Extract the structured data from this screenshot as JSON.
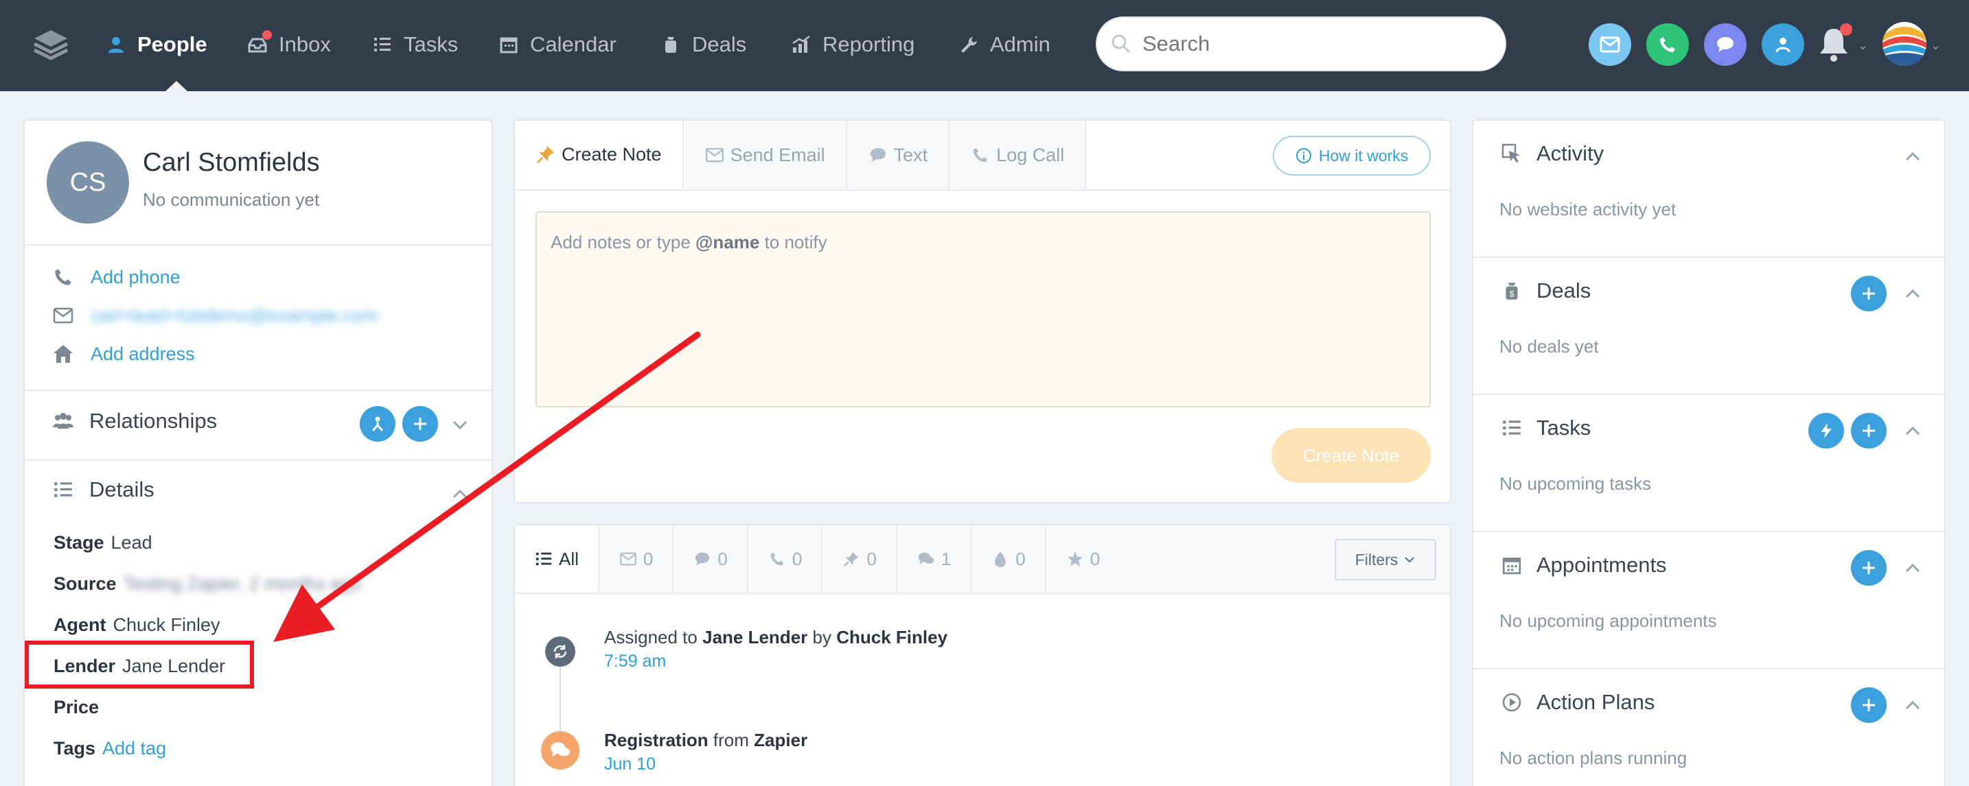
{
  "topnav": {
    "items": [
      {
        "label": "People",
        "icon": "people-icon",
        "active": true
      },
      {
        "label": "Inbox",
        "icon": "inbox-icon",
        "active": false
      },
      {
        "label": "Tasks",
        "icon": "tasks-icon",
        "active": false
      },
      {
        "label": "Calendar",
        "icon": "calendar-icon",
        "active": false
      },
      {
        "label": "Deals",
        "icon": "deals-icon",
        "active": false
      },
      {
        "label": "Reporting",
        "icon": "reporting-icon",
        "active": false
      },
      {
        "label": "Admin",
        "icon": "admin-icon",
        "active": false
      }
    ],
    "search_placeholder": "Search"
  },
  "contact": {
    "initials": "CS",
    "name": "Carl Stomfields",
    "status": "No communication yet",
    "add_phone": "Add phone",
    "email": "carl+lead+fubdemo@example.com",
    "add_address": "Add address"
  },
  "relationships": {
    "title": "Relationships"
  },
  "details": {
    "title": "Details",
    "stage_label": "Stage",
    "stage_value": "Lead",
    "source_label": "Source",
    "source_value": "Testing Zapier, 2 months ago",
    "agent_label": "Agent",
    "agent_value": "Chuck Finley",
    "lender_label": "Lender",
    "lender_value": "Jane Lender",
    "price_label": "Price",
    "tags_label": "Tags",
    "tags_value": "Add tag"
  },
  "composer": {
    "tabs": [
      "Create Note",
      "Send Email",
      "Text",
      "Log Call"
    ],
    "how_it_works": "How it works",
    "placeholder_pre": "Add notes or type",
    "placeholder_bold": "@name",
    "placeholder_post": "to notify",
    "create_button": "Create Note"
  },
  "feed": {
    "tabs": [
      {
        "label": "All",
        "icon": "list-icon"
      },
      {
        "label": "0",
        "icon": "email-icon"
      },
      {
        "label": "0",
        "icon": "chat-icon"
      },
      {
        "label": "0",
        "icon": "phone-icon"
      },
      {
        "label": "0",
        "icon": "pin-icon"
      },
      {
        "label": "1",
        "icon": "messages-icon"
      },
      {
        "label": "0",
        "icon": "drop-icon"
      },
      {
        "label": "0",
        "icon": "star-icon"
      }
    ],
    "filters": "Filters",
    "events": [
      {
        "pre": "Assigned to",
        "b1": "Jane Lender",
        "mid": "by",
        "b2": "Chuck Finley",
        "time": "7:59 am"
      },
      {
        "pre": "",
        "b1": "Registration",
        "mid": "from",
        "b2": "Zapier",
        "time": "Jun 10"
      }
    ]
  },
  "sidebar": {
    "sections": [
      {
        "title": "Activity",
        "empty": "No website activity yet"
      },
      {
        "title": "Deals",
        "empty": "No deals yet"
      },
      {
        "title": "Tasks",
        "empty": "No upcoming tasks"
      },
      {
        "title": "Appointments",
        "empty": "No upcoming appointments"
      },
      {
        "title": "Action Plans",
        "empty": "No action plans running"
      }
    ]
  },
  "colors": {
    "accent": "#3aa1dd",
    "nav": "#323d4b",
    "highlight": "#ec1c24"
  }
}
